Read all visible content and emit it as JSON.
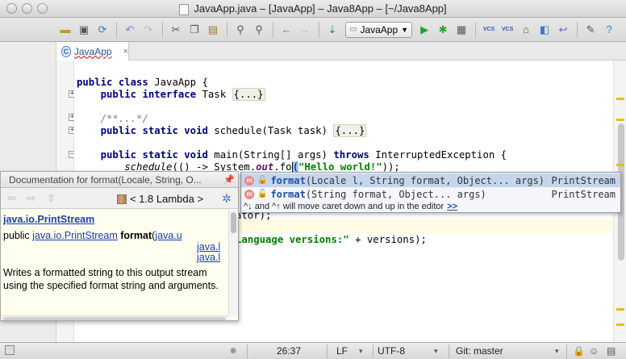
{
  "window": {
    "title": "JavaApp.java – [JavaApp] – Java8App – [~/Java8App]"
  },
  "toolbar": {
    "run_config": "JavaApp",
    "vcs_label": "VCS",
    "icons": [
      "folder-icon",
      "save-icon",
      "sync-icon",
      "undo-icon",
      "redo-icon",
      "cut-icon",
      "copy-icon",
      "paste-icon",
      "find-icon",
      "replace-icon",
      "back-icon",
      "forward-icon",
      "make-icon",
      "run-icon",
      "debug-icon",
      "coverage-icon",
      "vcs-update-icon",
      "vcs-commit-icon",
      "vcs-history-icon",
      "vcs-compare-icon",
      "vcs-revert-icon",
      "settings-icon",
      "help-icon"
    ]
  },
  "tabs": [
    {
      "label": "JavaApp",
      "close": "×"
    }
  ],
  "editor": {
    "lines": {
      "l1_kw": "public class",
      "l1_rest": " JavaApp {",
      "l2_kw": "public interface",
      "l2_name": " Task ",
      "l2_fold": "{...}",
      "l3_cmt": "/**...*/",
      "l4_kw": "public static void",
      "l4_rest": " schedule(Task task) ",
      "l4_fold": "{...}",
      "l5_kw": "public static void",
      "l5_rest": " main(String[] args) ",
      "l5_kw2": "throws",
      "l5_rest2": " InterruptedException {",
      "l6_call": "schedule",
      "l6_mid": "(() -> System.",
      "l6_out": "out",
      "l6_fo": ".fo",
      "l6_paren": "(",
      "l6_str": "\"Hello world!\"",
      "l6_end": "));",
      "l7_text": "ator);",
      "l8_str": "Language versions:\"",
      "l8_rest": " + versions);"
    }
  },
  "completion": {
    "items": [
      {
        "icon": "m",
        "name": "format",
        "signature": "(Locale l, String format, Object... args)",
        "type": "PrintStream",
        "selected": true
      },
      {
        "icon": "m",
        "name": "format",
        "signature": "(String format, Object... args)",
        "type": "PrintStream",
        "selected": false
      }
    ],
    "hint": "^↓ and ^↑ will move caret down and up in the editor",
    "hint_link": ">>"
  },
  "documentation": {
    "header": "Documentation for format(Locale, String, O...",
    "library": "< 1.8 Lambda >",
    "class_link": "java.io.PrintStream",
    "sig_public": "public ",
    "sig_type": "java.io.PrintStream",
    "sig_method": " format",
    "sig_paren": "(",
    "sig_param1": "java.u",
    "sig_param2": "java.l",
    "sig_param3": "java.l",
    "description": "Writes a formatted string to this output stream using the specified format string and arguments."
  },
  "statusbar": {
    "position": "26:37",
    "line_sep": "LF",
    "encoding": "UTF-8",
    "vcs": "Git: master"
  },
  "colors": {
    "keyword": "#000080",
    "string": "#008000",
    "current_line": "#fffae3",
    "popup_selected": "#c5d6ec",
    "doc_background": "#fffff0"
  }
}
